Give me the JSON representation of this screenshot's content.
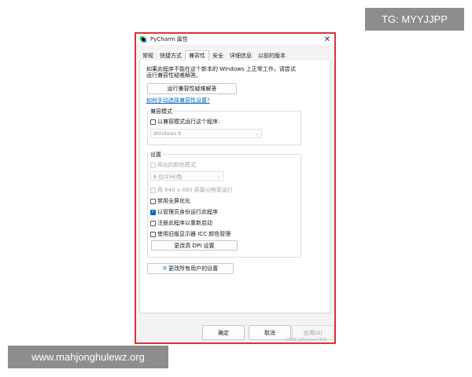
{
  "overlays": {
    "tag": "TG: MYYJJPP",
    "website": "www.mahjonghulewz.org"
  },
  "window": {
    "title": "PyCharm 属性",
    "close_glyph": "✕"
  },
  "tabs": [
    {
      "label": "常规",
      "active": false
    },
    {
      "label": "快捷方式",
      "active": false
    },
    {
      "label": "兼容性",
      "active": true
    },
    {
      "label": "安全",
      "active": false
    },
    {
      "label": "详细信息",
      "active": false
    },
    {
      "label": "以前的版本",
      "active": false
    }
  ],
  "compat": {
    "intro_line1": "如果此程序不能在这个新本的 Windows 上正常工作，请尝试",
    "intro_line2": "运行兼容性疑难解答。",
    "troubleshooter_button": "运行兼容性疑难解答",
    "manual_link": "如何手动选择兼容性设置?",
    "mode_group": {
      "label": "兼容模式",
      "checkbox_label": "以兼容模式运行这个程序:",
      "checked": false,
      "os_select": "Windows 8"
    },
    "settings_group": {
      "label": "设置",
      "reduced_color": {
        "label": "简化的颜色模式",
        "checked": false,
        "disabled": true
      },
      "color_select": "8 位(256)色",
      "low_res": {
        "label": "用 640 x 480 屏幕分辨率运行",
        "checked": false,
        "disabled": true
      },
      "disable_fullscreen": {
        "label": "禁用全屏优化",
        "checked": false
      },
      "run_as_admin": {
        "label": "以管理员身份运行此程序",
        "checked": true
      },
      "register_restart": {
        "label": "注册此程序以重新启动",
        "checked": false
      },
      "legacy_icc": {
        "label": "使用旧版显示器 ICC 颜色管理",
        "checked": false
      },
      "dpi_button": "更改高 DPI 设置"
    },
    "all_users_button": "更改所有用户的设置"
  },
  "footer": {
    "ok": "确定",
    "cancel": "取消",
    "apply": "应用(A)",
    "watermark": "CSDN @Fiunaa小探测"
  },
  "colors": {
    "accent": "#0067c0",
    "frame_highlight": "#d9343a"
  },
  "icons": {
    "app": "pycharm-icon",
    "shield": "uac-shield-icon",
    "close": "close-icon",
    "check": "✓",
    "chevron": "⌄"
  }
}
